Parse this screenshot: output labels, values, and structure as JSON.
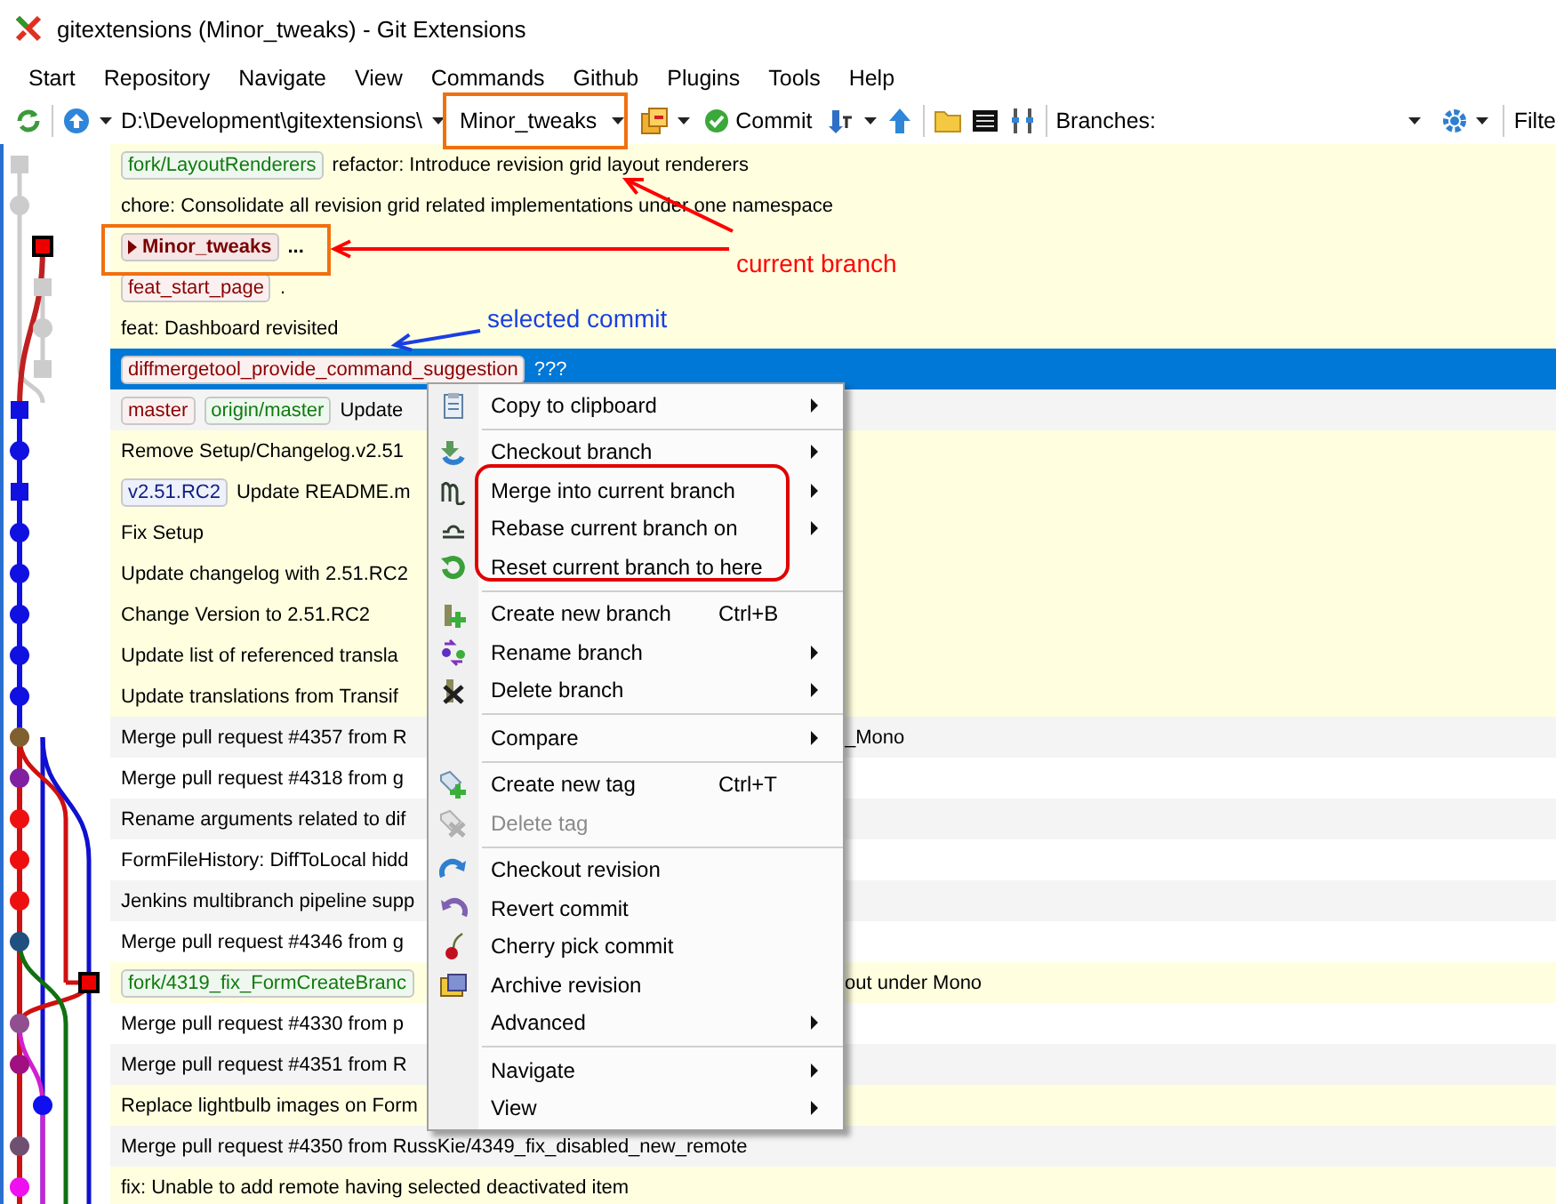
{
  "window": {
    "title": "gitextensions (Minor_tweaks) - Git Extensions"
  },
  "menu_bar": [
    "Start",
    "Repository",
    "Navigate",
    "View",
    "Commands",
    "Github",
    "Plugins",
    "Tools",
    "Help"
  ],
  "toolbar": {
    "path": "D:\\Development\\gitextensions\\",
    "branch": "Minor_tweaks",
    "commit_label": "Commit",
    "branches_label": "Branches:",
    "filter_label": "Filte"
  },
  "rows": [
    {
      "refs": [
        {
          "name": "fork/LayoutRenderers",
          "kind": "remote"
        }
      ],
      "message": "refactor: Introduce revision grid layout renderers",
      "highlighted": true,
      "selected": false
    },
    {
      "refs": [],
      "message": "chore: Consolidate all revision grid related implementations under one namespace",
      "highlighted": true,
      "selected": false
    },
    {
      "refs": [
        {
          "name": "Minor_tweaks",
          "kind": "head"
        }
      ],
      "message": "...",
      "highlighted": true,
      "selected": false
    },
    {
      "refs": [
        {
          "name": "feat_start_page",
          "kind": "local"
        }
      ],
      "message": ".",
      "highlighted": true,
      "selected": false
    },
    {
      "refs": [],
      "message": "feat: Dashboard revisited",
      "highlighted": true,
      "selected": false
    },
    {
      "refs": [
        {
          "name": "diffmergetool_provide_command_suggestion",
          "kind": "local"
        }
      ],
      "message": "???",
      "highlighted": false,
      "selected": true
    },
    {
      "refs": [
        {
          "name": "master",
          "kind": "local"
        },
        {
          "name": "origin/master",
          "kind": "remote"
        }
      ],
      "message": "Update",
      "highlighted": false,
      "selected": false
    },
    {
      "refs": [],
      "message": "Remove Setup/Changelog.v2.51",
      "highlighted": true,
      "selected": false
    },
    {
      "refs": [
        {
          "name": "v2.51.RC2",
          "kind": "tag"
        }
      ],
      "message": "Update README.m",
      "highlighted": true,
      "selected": false
    },
    {
      "refs": [],
      "message": "Fix Setup",
      "highlighted": true,
      "selected": false
    },
    {
      "refs": [],
      "message": "Update changelog with 2.51.RC2",
      "highlighted": true,
      "selected": false
    },
    {
      "refs": [],
      "message": "Change Version to 2.51.RC2",
      "highlighted": true,
      "selected": false
    },
    {
      "refs": [],
      "message": "Update list of referenced transla",
      "highlighted": true,
      "selected": false
    },
    {
      "refs": [],
      "message": "Update translations from Transif",
      "highlighted": true,
      "selected": false
    },
    {
      "refs": [],
      "message": "Merge pull request #4357 from R",
      "tail": "_Mono",
      "highlighted": false,
      "selected": false
    },
    {
      "refs": [],
      "message": "Merge pull request #4318 from g",
      "highlighted": false,
      "selected": false
    },
    {
      "refs": [],
      "message": "Rename arguments related to dif",
      "highlighted": false,
      "selected": false
    },
    {
      "refs": [],
      "message": "FormFileHistory: DiffToLocal hidd",
      "highlighted": false,
      "selected": false
    },
    {
      "refs": [],
      "message": "Jenkins multibranch pipeline supp",
      "highlighted": false,
      "selected": false
    },
    {
      "refs": [],
      "message": "Merge pull request #4346 from g",
      "highlighted": false,
      "selected": false
    },
    {
      "refs": [
        {
          "name": "fork/4319_fix_FormCreateBranc",
          "kind": "remote"
        }
      ],
      "message": "",
      "tail": "out under Mono",
      "highlighted": true,
      "selected": false
    },
    {
      "refs": [],
      "message": "Merge pull request #4330 from p",
      "highlighted": false,
      "selected": false
    },
    {
      "refs": [],
      "message": "Merge pull request #4351 from R",
      "highlighted": false,
      "selected": false
    },
    {
      "refs": [],
      "message": "Replace lightbulb images on Form",
      "highlighted": true,
      "selected": false
    },
    {
      "refs": [],
      "message": "Merge pull request #4350 from RussKie/4349_fix_disabled_new_remote",
      "highlighted": false,
      "selected": false
    },
    {
      "refs": [],
      "message": "fix: Unable to add remote having selected deactivated item",
      "highlighted": true,
      "selected": false
    }
  ],
  "context_menu": [
    {
      "kind": "item",
      "label": "Copy to clipboard",
      "submenu": true,
      "disabled": false
    },
    {
      "kind": "separator"
    },
    {
      "kind": "item",
      "label": "Checkout branch",
      "submenu": true,
      "disabled": false
    },
    {
      "kind": "item",
      "label": "Merge into current branch",
      "submenu": true,
      "disabled": false
    },
    {
      "kind": "item",
      "label": "Rebase current branch on",
      "submenu": true,
      "disabled": false
    },
    {
      "kind": "item",
      "label": "Reset current branch to here",
      "submenu": false,
      "disabled": false
    },
    {
      "kind": "separator"
    },
    {
      "kind": "item",
      "label": "Create new branch",
      "shortcut": "Ctrl+B",
      "submenu": false,
      "disabled": false
    },
    {
      "kind": "item",
      "label": "Rename branch",
      "submenu": true,
      "disabled": false
    },
    {
      "kind": "item",
      "label": "Delete branch",
      "submenu": true,
      "disabled": false
    },
    {
      "kind": "separator"
    },
    {
      "kind": "item",
      "label": "Compare",
      "submenu": true,
      "disabled": false
    },
    {
      "kind": "separator"
    },
    {
      "kind": "item",
      "label": "Create new tag",
      "shortcut": "Ctrl+T",
      "submenu": false,
      "disabled": false
    },
    {
      "kind": "item",
      "label": "Delete tag",
      "submenu": false,
      "disabled": true
    },
    {
      "kind": "separator"
    },
    {
      "kind": "item",
      "label": "Checkout revision",
      "submenu": false,
      "disabled": false
    },
    {
      "kind": "item",
      "label": "Revert commit",
      "submenu": false,
      "disabled": false
    },
    {
      "kind": "item",
      "label": "Cherry pick commit",
      "submenu": false,
      "disabled": false
    },
    {
      "kind": "item",
      "label": "Archive revision",
      "submenu": false,
      "disabled": false
    },
    {
      "kind": "item",
      "label": "Advanced",
      "submenu": true,
      "disabled": false
    },
    {
      "kind": "separator"
    },
    {
      "kind": "item",
      "label": "Navigate",
      "submenu": true,
      "disabled": false
    },
    {
      "kind": "item",
      "label": "View",
      "submenu": true,
      "disabled": false
    }
  ],
  "annotations": [
    {
      "text": "current branch",
      "color": "#ff0000"
    },
    {
      "text": "selected commit",
      "color": "#1a3fe0"
    }
  ]
}
